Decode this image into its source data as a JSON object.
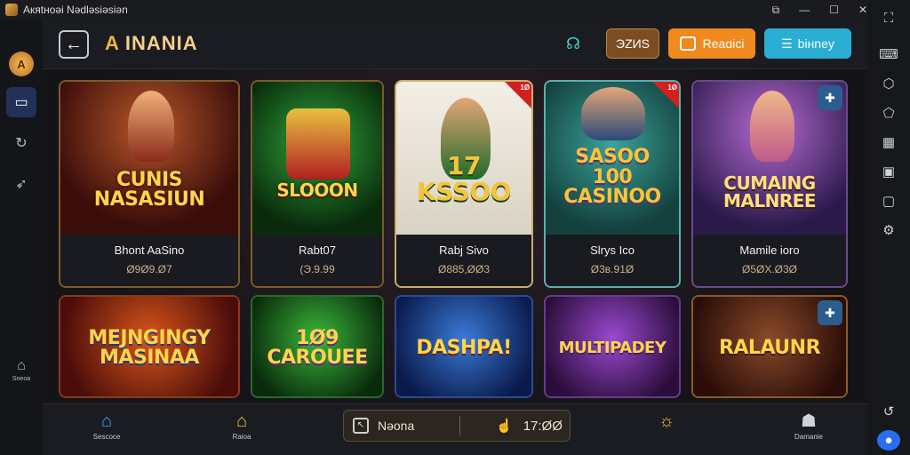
{
  "window": {
    "title": "Aкяtнoəi Nədləsiəsiən",
    "minimize": "—",
    "maximize": "☐",
    "close": "✕",
    "restore": "⧉"
  },
  "left_sidebar": {
    "avatar": "A",
    "items": [
      {
        "icon": "tv-icon"
      },
      {
        "icon": "refresh-icon"
      },
      {
        "icon": "wing-icon"
      }
    ],
    "lower_label": "Sneoa"
  },
  "right_sidebar": {
    "items": [
      "expand-icon",
      "keyboard-icon",
      "shape-icon",
      "shake-icon",
      "scan-icon",
      "display-icon",
      "window-icon",
      "settings-icon",
      "back-icon",
      "home-icon"
    ]
  },
  "header": {
    "back": "←",
    "logo": "A",
    "brand": "INANIA",
    "coin_label": "ЭZИS",
    "orange_button": "Reaɑici",
    "teal_button": "biнney"
  },
  "cards": [
    {
      "art": "CUNIS NASASIUN",
      "name": "Bhont AaSino",
      "price": "Ø9Ø9.Ø7",
      "badge": ""
    },
    {
      "art": "SLOOON",
      "name": "Rabt07",
      "price": "(Э.9.99",
      "badge": ""
    },
    {
      "art": "17 KSSOO",
      "name": "Rabj Sivo",
      "price": "Ø885,ØØ3",
      "badge": "1Ø"
    },
    {
      "art": "SASOO 100 CASINOO",
      "name": "Slrys Ico",
      "price": "Ø3ʙ.91Ø",
      "badge": "1Ø"
    },
    {
      "art": "CUMAING MALNREE",
      "name": "Mamile ioro",
      "price": "Ø5ØX.Ø3Ø",
      "badge": ""
    },
    {
      "art": "MEJNGINGY MASINAA",
      "name": "",
      "price": "",
      "badge": ""
    },
    {
      "art": "1Ø9 CAROUEE",
      "name": "",
      "price": "",
      "badge": ""
    },
    {
      "art": "DASHPA!",
      "name": "",
      "price": "",
      "badge": ""
    },
    {
      "art": "MULTIPADEY",
      "name": "",
      "price": "",
      "badge": ""
    },
    {
      "art": "RALAUNR",
      "name": "",
      "price": "",
      "badge": ""
    }
  ],
  "bottom": {
    "home_label": "Sescoce",
    "shop_label": "Raioa",
    "wallet_left": "Nəona",
    "wallet_right": "17:ØØ",
    "profile_label": "Damanie"
  }
}
